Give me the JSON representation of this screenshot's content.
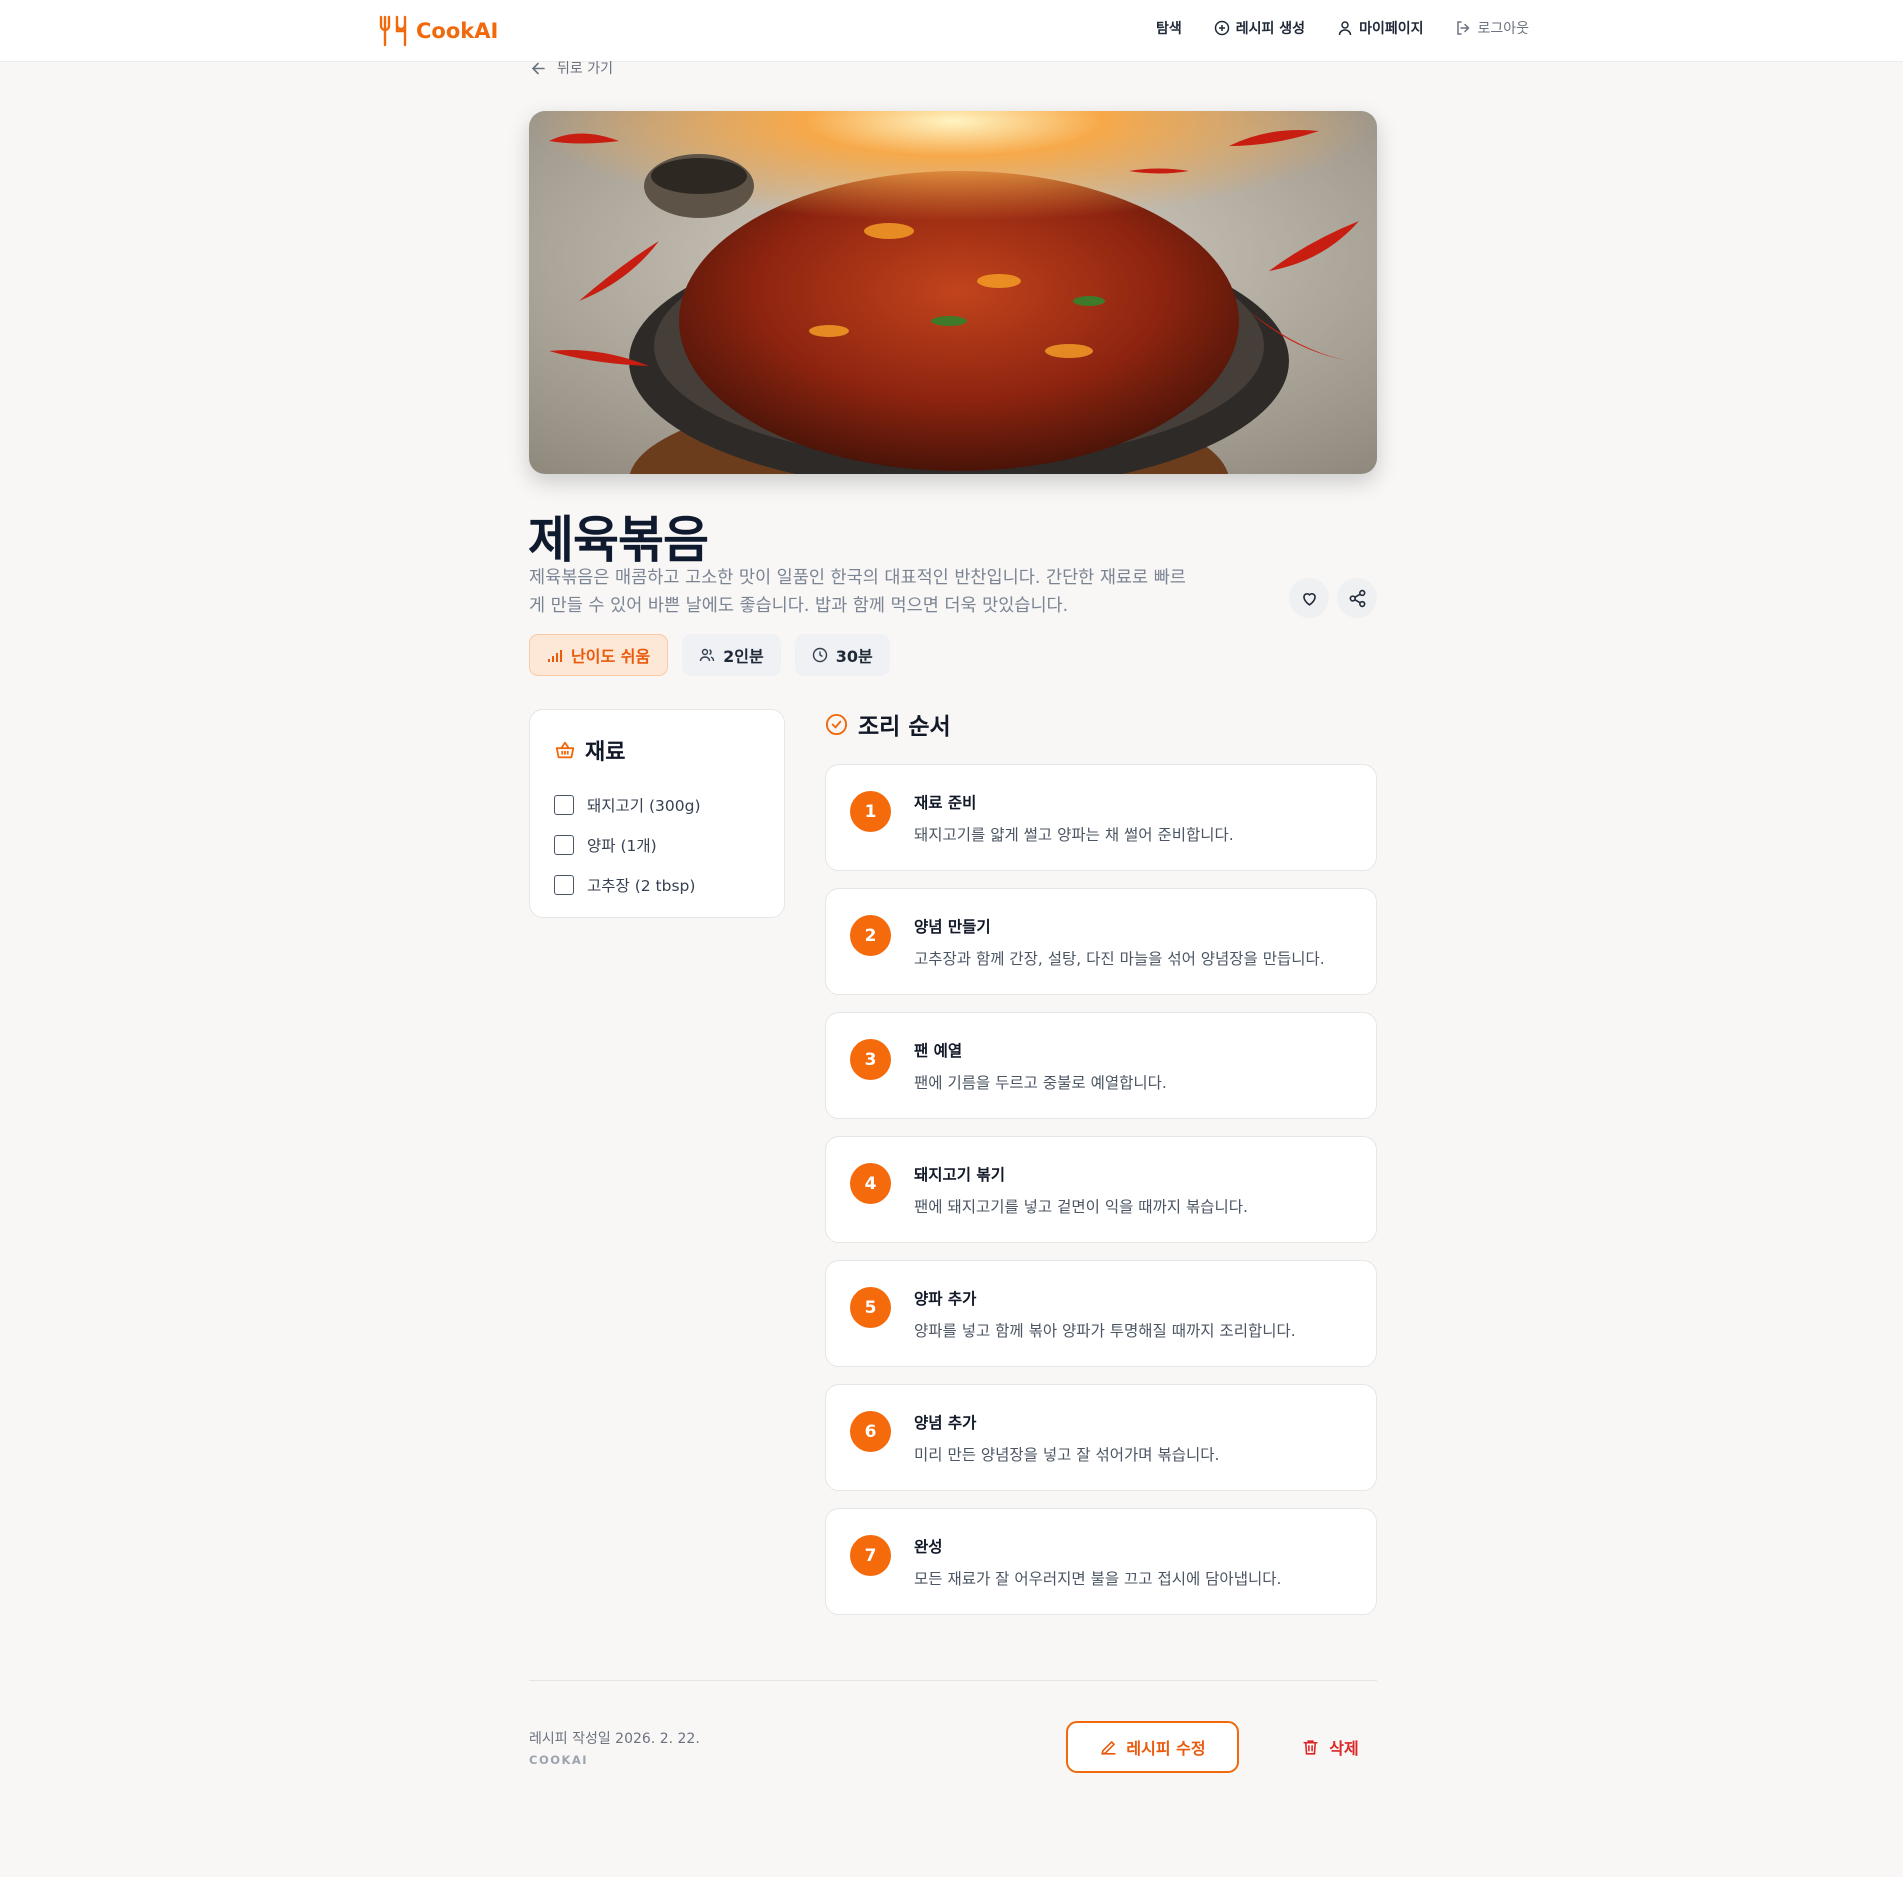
{
  "header": {
    "brand": "CookAI",
    "nav": {
      "explore": "탐색",
      "generate": "레시피 생성",
      "mypage": "마이페이지",
      "logout": "로그아웃"
    }
  },
  "back_label": "뒤로 가기",
  "recipe": {
    "title": "제육볶음",
    "description": "제육볶음은 매콤하고 고소한 맛이 일품인 한국의 대표적인 반찬입니다. 간단한 재료로 빠르게 만들 수 있어 바쁜 날에도 좋습니다. 밥과 함께 먹으면 더욱 맛있습니다.",
    "difficulty": "난이도 쉬움",
    "servings": "2인분",
    "time": "30분"
  },
  "ingredients": {
    "title": "재료",
    "items": [
      "돼지고기 (300g)",
      "양파 (1개)",
      "고추장 (2 tbsp)"
    ]
  },
  "steps": {
    "title": "조리 순서",
    "items": [
      {
        "num": "1",
        "title": "재료 준비",
        "desc": "돼지고기를 얇게 썰고 양파는 채 썰어 준비합니다."
      },
      {
        "num": "2",
        "title": "양념 만들기",
        "desc": "고추장과 함께 간장, 설탕, 다진 마늘을 섞어 양념장을 만듭니다."
      },
      {
        "num": "3",
        "title": "팬 예열",
        "desc": "팬에 기름을 두르고 중불로 예열합니다."
      },
      {
        "num": "4",
        "title": "돼지고기 볶기",
        "desc": "팬에 돼지고기를 넣고 겉면이 익을 때까지 볶습니다."
      },
      {
        "num": "5",
        "title": "양파 추가",
        "desc": "양파를 넣고 함께 볶아 양파가 투명해질 때까지 조리합니다."
      },
      {
        "num": "6",
        "title": "양념 추가",
        "desc": "미리 만든 양념장을 넣고 잘 섞어가며 볶습니다."
      },
      {
        "num": "7",
        "title": "완성",
        "desc": "모든 재료가 잘 어우러지면 불을 끄고 접시에 담아냅니다."
      }
    ]
  },
  "footer": {
    "created": "레시피 작성일 2026. 2. 22.",
    "credit": "COOKAI",
    "edit_label": "레시피 수정",
    "delete_label": "삭제"
  },
  "colors": {
    "accent": "#f06a0d",
    "danger": "#dc2626",
    "background": "#f8f7f5"
  },
  "icons": {
    "brand": "utensils-icon",
    "generate": "plus-circle-icon",
    "mypage": "user-icon",
    "logout": "logout-icon",
    "back": "arrow-left-icon",
    "like": "heart-icon",
    "share": "share-icon",
    "difficulty": "signal-icon",
    "servings": "users-icon",
    "time": "clock-icon",
    "ingredients": "basket-icon",
    "steps": "check-circle-icon",
    "edit": "pencil-icon",
    "delete": "trash-icon"
  }
}
